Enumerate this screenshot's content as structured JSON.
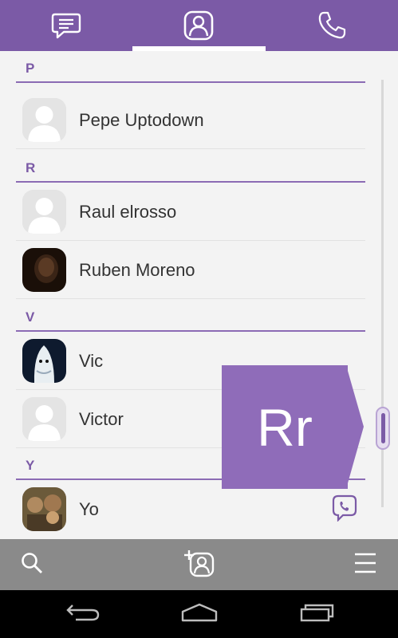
{
  "tabs": [
    {
      "icon": "chat-bubble-icon",
      "active": false
    },
    {
      "icon": "contact-person-icon",
      "active": true
    },
    {
      "icon": "phone-icon",
      "active": false
    }
  ],
  "sections": [
    {
      "letter": "P",
      "contacts": [
        {
          "name": "Pepe Uptodown",
          "avatar": "default",
          "viber": false
        }
      ]
    },
    {
      "letter": "R",
      "contacts": [
        {
          "name": "Raul elrosso",
          "avatar": "default",
          "viber": false
        },
        {
          "name": "Ruben Moreno",
          "avatar": "photo",
          "viber": false
        }
      ]
    },
    {
      "letter": "V",
      "contacts": [
        {
          "name": "Vic",
          "avatar": "photo",
          "viber": false
        },
        {
          "name": "Victor",
          "avatar": "default",
          "viber": true
        }
      ]
    },
    {
      "letter": "Y",
      "contacts": [
        {
          "name": "Yo",
          "avatar": "photo",
          "viber": true
        }
      ]
    }
  ],
  "fast_scroll": {
    "label": "Rr"
  },
  "bottom_bar": {
    "icons": [
      "search-icon",
      "add-contact-icon",
      "menu-icon"
    ]
  },
  "system_nav": {
    "icons": [
      "back-icon",
      "home-icon",
      "recent-apps-icon"
    ]
  },
  "colors": {
    "brand": "#7b5aa6",
    "popup": "#8f6cb9",
    "bottom_bar": "#8a8a8a"
  }
}
